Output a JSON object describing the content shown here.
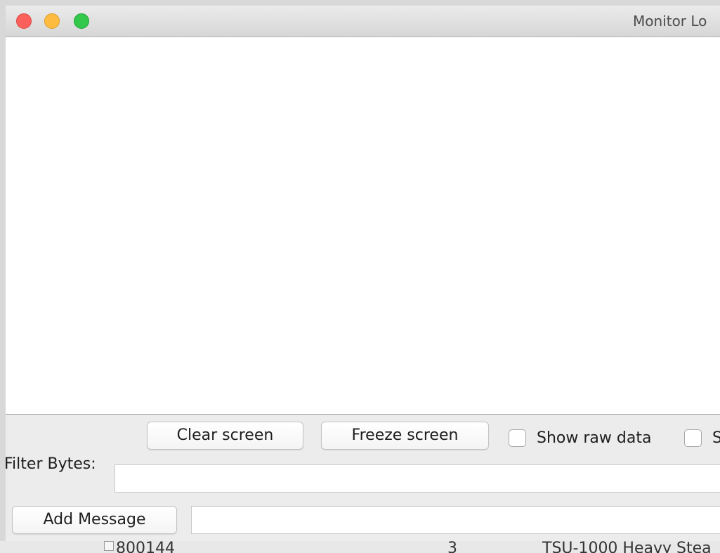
{
  "window": {
    "title": "Monitor Lo",
    "controls": [
      "close-icon",
      "minimize-icon",
      "zoom-icon"
    ],
    "control_colors": {
      "close": "#fc605c",
      "minimize": "#fdbc40",
      "zoom": "#34c84a"
    }
  },
  "monitor": {
    "content": ""
  },
  "toolbar": {
    "clear_label": "Clear screen",
    "freeze_label": "Freeze screen",
    "raw_data_label": "Show raw data",
    "raw_data_checked": false,
    "second_checkbox_label": "S",
    "second_checkbox_checked": false
  },
  "filter": {
    "label": "Filter Bytes:",
    "value": ""
  },
  "add_message": {
    "button_label": "Add Message",
    "value": ""
  },
  "background_table": {
    "row": [
      "800144",
      "3",
      "TSU-1000 Heavy Stea"
    ]
  }
}
